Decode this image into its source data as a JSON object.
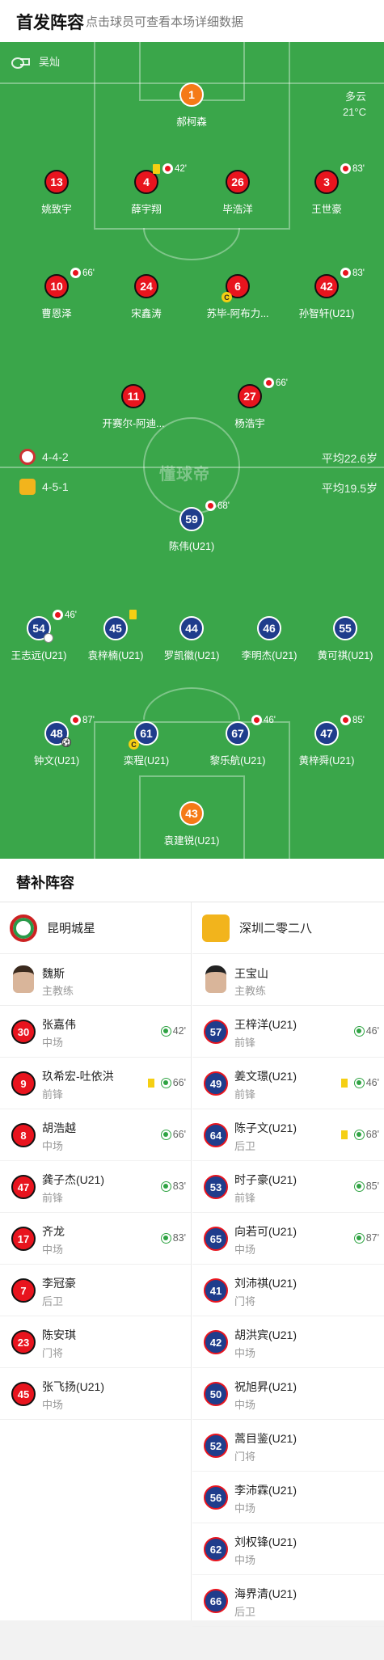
{
  "header": {
    "title": "首发阵容",
    "hint": "点击球员可查看本场详细数据"
  },
  "pitch": {
    "referee": "吴灿",
    "weather": {
      "condition": "多云",
      "temperature": "21°C"
    },
    "watermark": "懂球帝",
    "home_formation": {
      "shape": "4-4-2",
      "avg_age": "平均22.6岁"
    },
    "away_formation": {
      "shape": "4-5-1",
      "avg_age": "平均19.5岁"
    }
  },
  "home_players": [
    {
      "num": "1",
      "name": "郝柯森",
      "event": ""
    },
    {
      "num": "13",
      "name": "姚致宇",
      "event": ""
    },
    {
      "num": "4",
      "name": "薛宇翔",
      "event": "42'"
    },
    {
      "num": "26",
      "name": "毕浩洋",
      "event": ""
    },
    {
      "num": "3",
      "name": "王世豪",
      "event": "83'"
    },
    {
      "num": "10",
      "name": "曹恩泽",
      "event": "66'"
    },
    {
      "num": "24",
      "name": "宋鑫涛",
      "event": ""
    },
    {
      "num": "6",
      "name": "苏毕-阿布力...",
      "event": ""
    },
    {
      "num": "42",
      "name": "孙智轩(U21)",
      "event": "83'"
    },
    {
      "num": "11",
      "name": "开赛尔-阿迪...",
      "event": ""
    },
    {
      "num": "27",
      "name": "杨浩宇",
      "event": "66'"
    }
  ],
  "away_players": [
    {
      "num": "59",
      "name": "陈伟(U21)",
      "event": "68'"
    },
    {
      "num": "54",
      "name": "王志远(U21)",
      "event": "46'"
    },
    {
      "num": "45",
      "name": "袁梓楠(U21)",
      "event": ""
    },
    {
      "num": "44",
      "name": "罗凯徽(U21)",
      "event": ""
    },
    {
      "num": "46",
      "name": "李明杰(U21)",
      "event": ""
    },
    {
      "num": "55",
      "name": "黄可祺(U21)",
      "event": ""
    },
    {
      "num": "48",
      "name": "钟文(U21)",
      "event": "87'"
    },
    {
      "num": "61",
      "name": "栾程(U21)",
      "event": ""
    },
    {
      "num": "67",
      "name": "黎乐航(U21)",
      "event": "46'"
    },
    {
      "num": "47",
      "name": "黄梓舜(U21)",
      "event": "85'"
    },
    {
      "num": "43",
      "name": "袁建锐(U21)",
      "event": ""
    }
  ],
  "subs": {
    "title": "替补阵容",
    "home": {
      "team": "昆明城星",
      "coach": {
        "name": "魏斯",
        "role": "主教练"
      },
      "players": [
        {
          "num": "30",
          "name": "张嘉伟",
          "pos": "中场",
          "in": "42'"
        },
        {
          "num": "9",
          "name": "玖希宏-吐依洪",
          "pos": "前锋",
          "in": "66'"
        },
        {
          "num": "8",
          "name": "胡浩越",
          "pos": "中场",
          "in": "66'"
        },
        {
          "num": "47",
          "name": "龚子杰(U21)",
          "pos": "前锋",
          "in": "83'"
        },
        {
          "num": "17",
          "name": "齐龙",
          "pos": "中场",
          "in": "83'"
        },
        {
          "num": "7",
          "name": "李冠豪",
          "pos": "后卫",
          "in": ""
        },
        {
          "num": "23",
          "name": "陈安琪",
          "pos": "门将",
          "in": ""
        },
        {
          "num": "45",
          "name": "张飞扬(U21)",
          "pos": "中场",
          "in": ""
        }
      ]
    },
    "away": {
      "team": "深圳二零二八",
      "coach": {
        "name": "王宝山",
        "role": "主教练"
      },
      "players": [
        {
          "num": "57",
          "name": "王梓洋(U21)",
          "pos": "前锋",
          "in": "46'"
        },
        {
          "num": "49",
          "name": "姜文璟(U21)",
          "pos": "前锋",
          "in": "46'"
        },
        {
          "num": "64",
          "name": "陈子文(U21)",
          "pos": "后卫",
          "in": "68'"
        },
        {
          "num": "53",
          "name": "时子豪(U21)",
          "pos": "前锋",
          "in": "85'"
        },
        {
          "num": "65",
          "name": "向若可(U21)",
          "pos": "中场",
          "in": "87'"
        },
        {
          "num": "41",
          "name": "刘沛祺(U21)",
          "pos": "门将",
          "in": ""
        },
        {
          "num": "42",
          "name": "胡洪宾(U21)",
          "pos": "中场",
          "in": ""
        },
        {
          "num": "50",
          "name": "祝旭昇(U21)",
          "pos": "中场",
          "in": ""
        },
        {
          "num": "52",
          "name": "蒿目鉴(U21)",
          "pos": "门将",
          "in": ""
        },
        {
          "num": "56",
          "name": "李沛霖(U21)",
          "pos": "中场",
          "in": ""
        },
        {
          "num": "62",
          "name": "刘权锋(U21)",
          "pos": "中场",
          "in": ""
        },
        {
          "num": "66",
          "name": "海界清(U21)",
          "pos": "后卫",
          "in": ""
        }
      ]
    }
  }
}
